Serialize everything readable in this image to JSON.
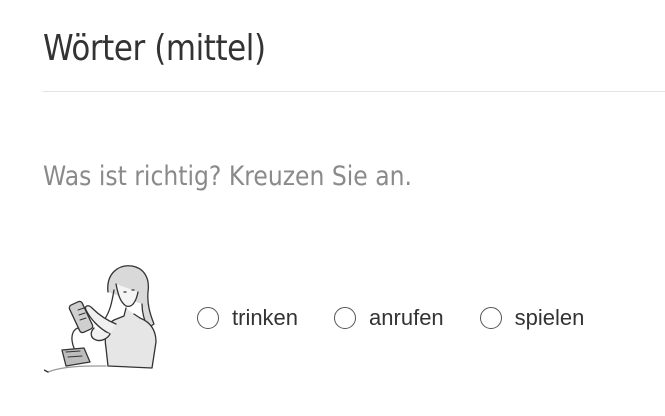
{
  "exercise": {
    "title": "Wörter (mittel)",
    "instruction": "Was ist richtig? Kreuzen Sie an."
  },
  "question": {
    "illustration_icon": "woman-using-phone-illustration",
    "options": [
      {
        "label": "trinken",
        "selected": false
      },
      {
        "label": "anrufen",
        "selected": false
      },
      {
        "label": "spielen",
        "selected": false
      }
    ]
  }
}
